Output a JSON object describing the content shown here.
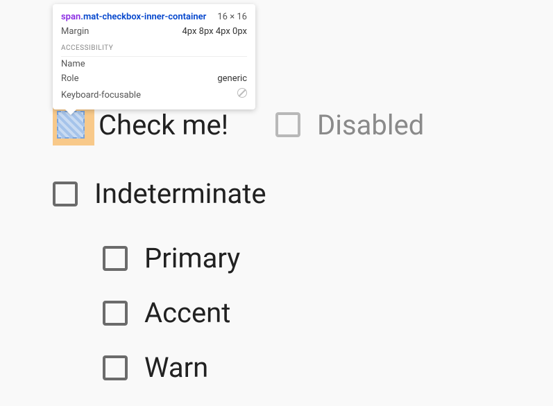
{
  "tooltip": {
    "element_tag": "span",
    "element_class": ".mat-checkbox-inner-container",
    "dimensions": "16 × 16",
    "margin_label": "Margin",
    "margin_value": "4px 8px 4px 0px",
    "section_accessibility": "ACCESSIBILITY",
    "name_label": "Name",
    "name_value": "",
    "role_label": "Role",
    "role_value": "generic",
    "focus_label": "Keyboard-focusable"
  },
  "checkboxes": {
    "check_me": "Check me!",
    "disabled": "Disabled",
    "indeterminate": "Indeterminate",
    "primary": "Primary",
    "accent": "Accent",
    "warn": "Warn"
  }
}
